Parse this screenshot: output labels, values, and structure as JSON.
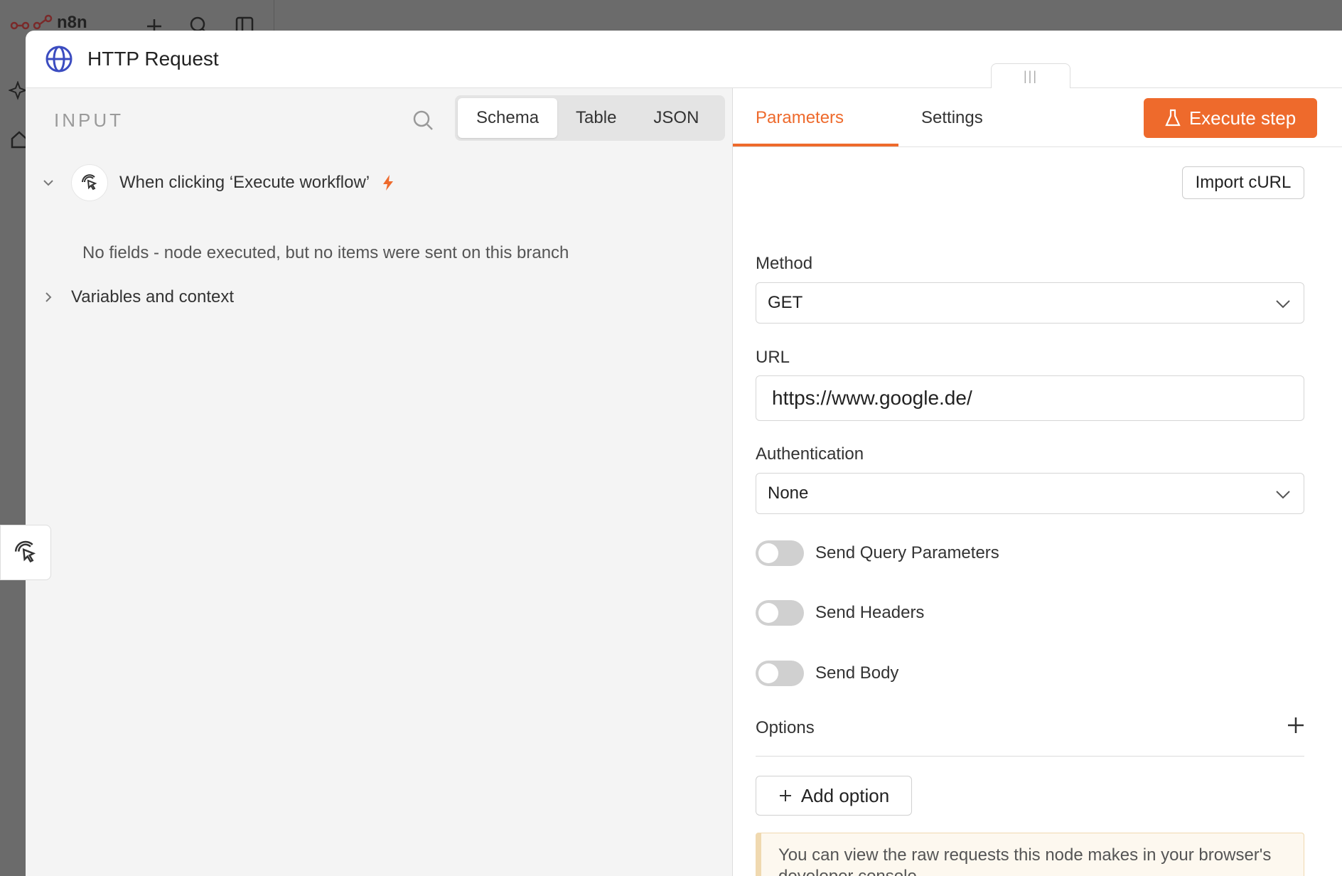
{
  "background": {
    "logo_text": "n8n"
  },
  "modal": {
    "title": "HTTP Request"
  },
  "input": {
    "label": "INPUT",
    "tabs": [
      "Schema",
      "Table",
      "JSON"
    ],
    "active_tab": "Schema",
    "trigger_name": "When clicking ‘Execute workflow’",
    "no_fields_message": "No fields - node executed, but no items were sent on this branch",
    "variables_label": "Variables and context"
  },
  "params": {
    "tabs": [
      "Parameters",
      "Settings"
    ],
    "active_tab": "Parameters",
    "execute_label": "Execute step",
    "import_curl_label": "Import cURL",
    "method": {
      "label": "Method",
      "value": "GET"
    },
    "url": {
      "label": "URL",
      "value": "https://www.google.de/"
    },
    "authentication": {
      "label": "Authentication",
      "value": "None"
    },
    "toggles": [
      {
        "label": "Send Query Parameters",
        "on": false
      },
      {
        "label": "Send Headers",
        "on": false
      },
      {
        "label": "Send Body",
        "on": false
      }
    ],
    "options_label": "Options",
    "add_option_label": "Add option",
    "notice": "You can view the raw requests this node makes in your browser's developer console"
  },
  "colors": {
    "accent": "#ee6a2c",
    "globe": "#3b4cc0"
  }
}
